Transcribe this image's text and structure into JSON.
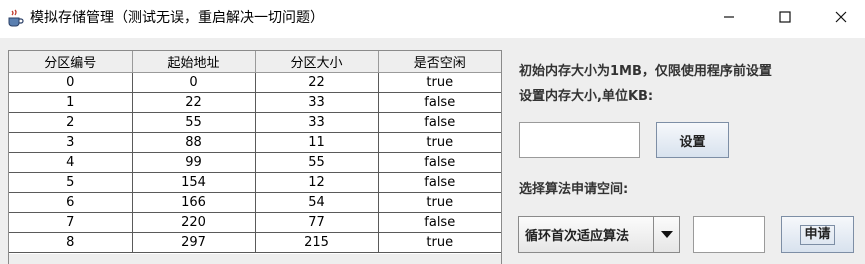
{
  "window": {
    "title": "模拟存储管理（测试无误，重启解决一切问题）",
    "icon": "java-cup-icon",
    "minimize_glyph": "—",
    "maximize_glyph": "☐",
    "close_glyph": "✕"
  },
  "table": {
    "headers": [
      "分区编号",
      "起始地址",
      "分区大小",
      "是否空闲"
    ],
    "rows": [
      [
        "0",
        "0",
        "22",
        "true"
      ],
      [
        "1",
        "22",
        "33",
        "false"
      ],
      [
        "2",
        "55",
        "33",
        "false"
      ],
      [
        "3",
        "88",
        "11",
        "true"
      ],
      [
        "4",
        "99",
        "55",
        "false"
      ],
      [
        "5",
        "154",
        "12",
        "false"
      ],
      [
        "6",
        "166",
        "54",
        "true"
      ],
      [
        "7",
        "220",
        "77",
        "false"
      ],
      [
        "8",
        "297",
        "215",
        "true"
      ]
    ]
  },
  "panel": {
    "info_line1": "初始内存大小为1MB，仅限使用程序前设置",
    "info_line2": "设置内存大小,单位KB:",
    "size_input_value": "",
    "set_button": "设置",
    "algo_label": "选择算法申请空间:",
    "algo_selected": "循环首次适应算法",
    "request_input_value": "",
    "request_button": "申请"
  }
}
